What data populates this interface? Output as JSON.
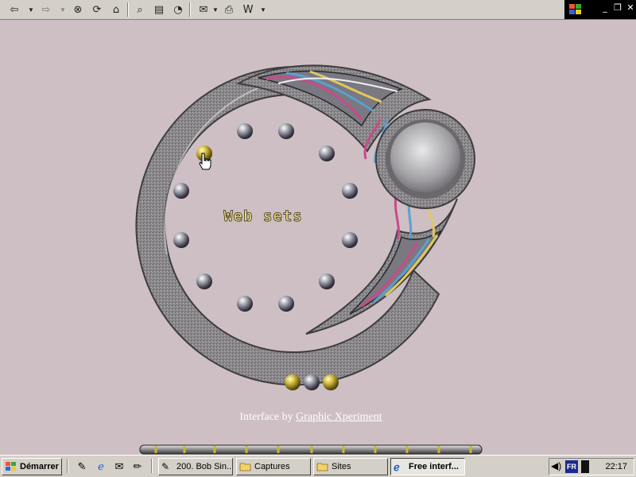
{
  "toolbar": {
    "buttons": [
      "back-icon",
      "forward-icon",
      "stop-icon",
      "refresh-icon",
      "home-icon",
      "search-icon",
      "favorites-icon",
      "history-icon",
      "mail-icon",
      "print-icon",
      "edit-icon"
    ]
  },
  "page": {
    "menu_title": "Web sets",
    "menu_items_count": 12,
    "active_item_color": "#c9b43a",
    "bottom_buttons": [
      {
        "color": "gold"
      },
      {
        "color": "silver"
      },
      {
        "color": "gold"
      }
    ],
    "credit_prefix": "Interface by ",
    "credit_link": "Graphic Xperiment"
  },
  "taskbar": {
    "start_label": "Démarrer",
    "tasks": [
      {
        "label": "200. Bob Sin...",
        "icon": "pencil-icon"
      },
      {
        "label": "Captures",
        "icon": "folder-icon"
      },
      {
        "label": "Sites",
        "icon": "folder-icon"
      },
      {
        "label": "Free interf...",
        "icon": "ie-icon",
        "active": true
      }
    ],
    "tray_lang": "FR",
    "clock": "22:17"
  },
  "colors": {
    "background": "#cdbfc3",
    "metal": "#8c8a8c",
    "gold": "#c9b43a"
  }
}
